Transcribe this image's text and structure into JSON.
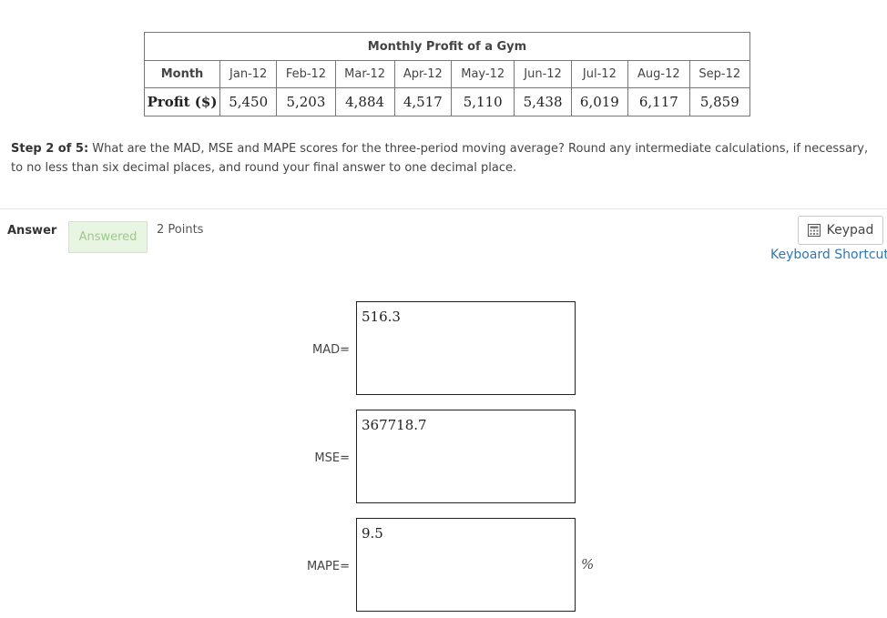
{
  "table": {
    "title": "Monthly Profit of a Gym",
    "row_header_month": "Month",
    "row_header_profit": "Profit ($)",
    "months": [
      "Jan-12",
      "Feb-12",
      "Mar-12",
      "Apr-12",
      "May-12",
      "Jun-12",
      "Jul-12",
      "Aug-12",
      "Sep-12"
    ],
    "profits": [
      "5,450",
      "5,203",
      "4,884",
      "4,517",
      "5,110",
      "5,438",
      "6,019",
      "6,117",
      "5,859"
    ]
  },
  "question": {
    "step": "Step 2 of 5:",
    "text": " What are the MAD, MSE and MAPE scores for the three-period moving average? Round any intermediate calculations, if necessary, to no less than six decimal places, and round your final answer to one decimal place."
  },
  "answer_bar": {
    "label": "Answer",
    "status": "Answered",
    "points": "2 Points",
    "keypad_label": "Keypad",
    "shortcuts_label": "Keyboard Shortcuts",
    "keypad_icon": "calculator-icon"
  },
  "fields": {
    "mad_label": "MAD=",
    "mad_value": "516.3",
    "mse_label": "MSE=",
    "mse_value": "367718.7",
    "mape_label": "MAPE=",
    "mape_value": "9.5",
    "mape_unit": "%"
  }
}
